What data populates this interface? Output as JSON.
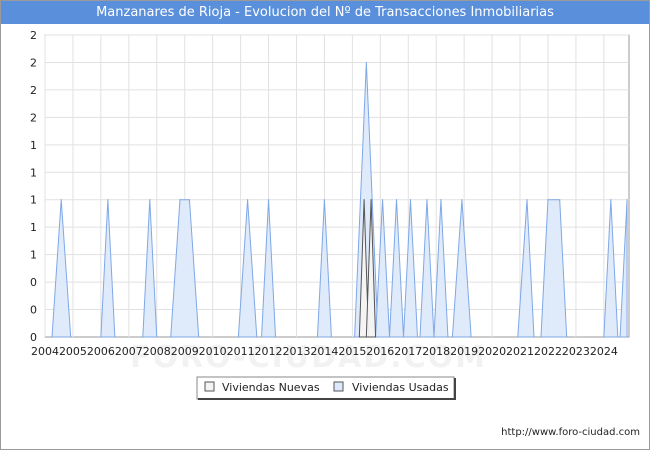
{
  "title": "Manzanares de Rioja - Evolucion del Nº de Transacciones Inmobiliarias",
  "footer_url": "http://www.foro-ciudad.com",
  "watermark": "FORO-CIUDAD.COM",
  "colors": {
    "title_bg": "#5a8fdc",
    "nuevas_fill": "#f4f4f4",
    "usadas_fill": "#dde9fa",
    "usadas_line": "#7fa8e6",
    "nuevas_line": "#555555"
  },
  "chart_data": {
    "type": "area",
    "title": "Manzanares de Rioja - Evolucion del Nº de Transacciones Inmobiliarias",
    "xlabel": "",
    "ylabel": "",
    "xlim": [
      2004,
      2024.9
    ],
    "ylim": [
      0,
      2.2
    ],
    "grid": true,
    "legend_position": "bottom",
    "x_tick_labels": [
      "2004",
      "2005",
      "2006",
      "2007",
      "2008",
      "2009",
      "2010",
      "2011",
      "2012",
      "2013",
      "2014",
      "2015",
      "2016",
      "2017",
      "2018",
      "2019",
      "2020",
      "2021",
      "2022",
      "2023",
      "2024"
    ],
    "y_tick_labels": [
      "0",
      "0",
      "0",
      "1",
      "1",
      "1",
      "1",
      "1",
      "2",
      "2",
      "2",
      "2"
    ],
    "series": [
      {
        "name": "Viviendas Nuevas",
        "points": [
          [
            2015.25,
            0
          ],
          [
            2015.42,
            1
          ],
          [
            2015.58,
            0
          ],
          [
            2015.5,
            0
          ],
          [
            2015.67,
            1
          ],
          [
            2015.83,
            0
          ]
        ]
      },
      {
        "name": "Viviendas Usadas",
        "points": [
          [
            2004.25,
            0
          ],
          [
            2004.58,
            1
          ],
          [
            2004.92,
            0
          ],
          [
            2006.0,
            0
          ],
          [
            2006.25,
            1
          ],
          [
            2006.5,
            0
          ],
          [
            2007.5,
            0
          ],
          [
            2007.75,
            1
          ],
          [
            2008.0,
            0
          ],
          [
            2008.5,
            0
          ],
          [
            2008.83,
            1
          ],
          [
            2009.17,
            1
          ],
          [
            2009.5,
            0
          ],
          [
            2010.92,
            0
          ],
          [
            2011.25,
            1
          ],
          [
            2011.58,
            0
          ],
          [
            2011.75,
            0
          ],
          [
            2012.0,
            1
          ],
          [
            2012.25,
            0
          ],
          [
            2013.75,
            0
          ],
          [
            2014.0,
            1
          ],
          [
            2014.25,
            0
          ],
          [
            2015.08,
            0
          ],
          [
            2015.5,
            2
          ],
          [
            2015.92,
            0
          ],
          [
            2015.83,
            0
          ],
          [
            2016.08,
            1
          ],
          [
            2016.33,
            0
          ],
          [
            2016.33,
            0
          ],
          [
            2016.58,
            1
          ],
          [
            2016.83,
            0
          ],
          [
            2016.83,
            0
          ],
          [
            2017.08,
            1
          ],
          [
            2017.33,
            0
          ],
          [
            2017.42,
            0
          ],
          [
            2017.67,
            1
          ],
          [
            2017.92,
            0
          ],
          [
            2017.92,
            0
          ],
          [
            2018.17,
            1
          ],
          [
            2018.42,
            0
          ],
          [
            2018.58,
            0
          ],
          [
            2018.92,
            1
          ],
          [
            2019.25,
            0
          ],
          [
            2020.92,
            0
          ],
          [
            2021.25,
            1
          ],
          [
            2021.5,
            0
          ],
          [
            2021.75,
            0
          ],
          [
            2022.0,
            1
          ],
          [
            2022.42,
            1
          ],
          [
            2022.67,
            0
          ],
          [
            2024.0,
            0
          ],
          [
            2024.25,
            1
          ],
          [
            2024.5,
            0
          ],
          [
            2024.58,
            0
          ],
          [
            2024.83,
            1
          ]
        ]
      }
    ]
  }
}
